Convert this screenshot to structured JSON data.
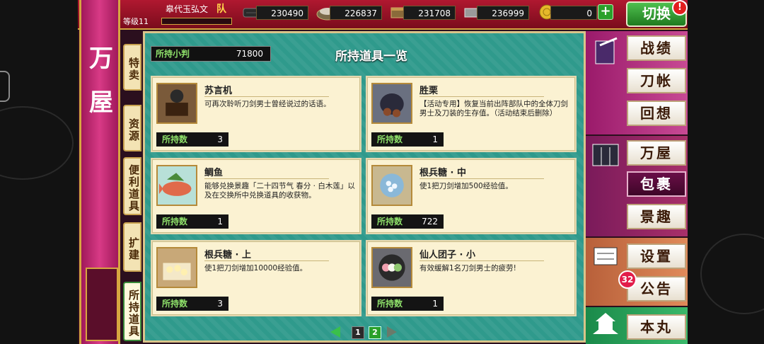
{
  "header": {
    "player_name": "皋代玉弘文",
    "team_label": "队",
    "level_label": "等级11",
    "resources": [
      {
        "icon": "charcoal-icon",
        "value": "230490"
      },
      {
        "icon": "steel-icon",
        "value": "226837"
      },
      {
        "icon": "coolant-icon",
        "value": "231708"
      },
      {
        "icon": "whetstone-icon",
        "value": "236999"
      }
    ],
    "coin": {
      "icon": "gold-coin-icon",
      "value": "0"
    },
    "plus_label": "+",
    "switch_label": "切换",
    "alert_label": "!"
  },
  "sidebar": {
    "title_chars": [
      "万",
      "屋"
    ],
    "tabs": [
      {
        "label": "特卖",
        "active": false
      },
      {
        "label": "资源",
        "active": false
      },
      {
        "label": "便利道具",
        "active": false
      },
      {
        "label": "扩建",
        "active": false
      },
      {
        "label": "所持道具",
        "active": true
      }
    ],
    "collapse_label": "‹"
  },
  "panel": {
    "title": "所持道具一览",
    "coin_label": "所持小判",
    "coin_value": "71800",
    "count_label": "所持数",
    "items": [
      {
        "name": "苏言机",
        "desc": "可再次聆听刀剑男士曾经说过的话语。",
        "count": "3",
        "icon": "gramophone-icon"
      },
      {
        "name": "胜栗",
        "desc": "【活动专用】恢复当前出阵部队中的全体刀剑男士及刀装的生存值。（活动结束后删除）",
        "count": "1",
        "icon": "chestnut-icon"
      },
      {
        "name": "鲷鱼",
        "desc": "能够兑换景趣「二十四节气 春分 · 白木莲」以及在交换所中兑换道具的收获物。",
        "count": "1",
        "icon": "sea-bream-icon"
      },
      {
        "name": "根兵糖 · 中",
        "desc": "使1把刀剑增加500经验值。",
        "count": "722",
        "icon": "konpeito-medium-icon"
      },
      {
        "name": "根兵糖 · 上",
        "desc": "使1把刀剑增加10000经验值。",
        "count": "3",
        "icon": "konpeito-large-icon"
      },
      {
        "name": "仙人团子 · 小",
        "desc": "有效缓解1名刀剑男士的疲劳!",
        "count": "1",
        "icon": "dango-icon"
      }
    ],
    "pager": {
      "pages": [
        "1",
        "2"
      ],
      "current": "2"
    }
  },
  "right_menu": {
    "buttons": [
      {
        "label": "战绩",
        "active": false
      },
      {
        "label": "刀帐",
        "active": false
      },
      {
        "label": "回想",
        "active": false
      },
      {
        "label": "万屋",
        "active": false
      },
      {
        "label": "包裹",
        "active": true
      },
      {
        "label": "景趣",
        "active": false
      },
      {
        "label": "设置",
        "active": false
      },
      {
        "label": "公告",
        "active": false
      },
      {
        "label": "本丸",
        "active": false
      }
    ],
    "notice_count": "32"
  },
  "colors": {
    "accent_red": "#b01830",
    "shop_pink": "#d83a86",
    "panel_teal": "#2f9a8c",
    "gold_border": "#d6a640",
    "count_green": "#8ee06a"
  }
}
